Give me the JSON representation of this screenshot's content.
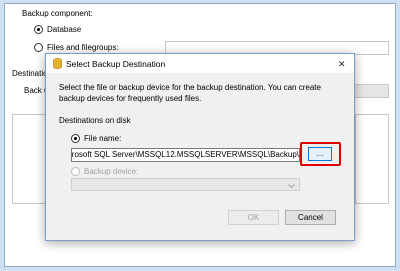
{
  "background": {
    "backup_component_label": "Backup component:",
    "database_label": "Database",
    "files_label": "Files and filegroups:",
    "destination_label": "Destinatio",
    "back_up_to_label": "Back u"
  },
  "dialog": {
    "title": "Select Backup Destination",
    "description": "Select the file or backup device for the backup destination. You can create backup devices for frequently used files.",
    "destinations_label": "Destinations on disk",
    "file_name_label": "File name:",
    "file_path": "rosoft SQL Server\\MSSQL12.MSSQLSERVER\\MSSQL\\Backup\\",
    "browse_label": "...",
    "backup_device_label": "Backup device:",
    "ok_label": "OK",
    "cancel_label": "Cancel",
    "close_glyph": "✕"
  },
  "colors": {
    "highlight": "#e00000",
    "accent": "#0078d7",
    "background": "#cfe0f3"
  }
}
